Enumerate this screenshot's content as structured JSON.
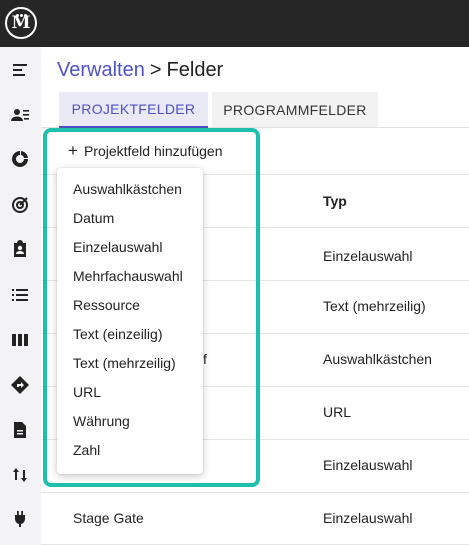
{
  "app": {
    "logo_text": "M"
  },
  "sidebar": {
    "icons": [
      "menu-icon",
      "user-list-icon",
      "donut-chart-icon",
      "target-icon",
      "clipboard-person-icon",
      "list-icon",
      "columns-icon",
      "direction-sign-icon",
      "document-icon",
      "sort-arrows-icon",
      "plug-icon"
    ]
  },
  "breadcrumb": {
    "parent": "Verwalten",
    "separator": ">",
    "current": "Felder"
  },
  "tabs": [
    {
      "label": "PROJEKTFELDER",
      "active": true
    },
    {
      "label": "PROGRAMMFELDER",
      "active": false
    }
  ],
  "add_button": {
    "icon": "+",
    "label": "Projektfeld hinzufügen"
  },
  "table": {
    "columns": [
      "Typ"
    ],
    "rows": [
      {
        "name": "",
        "type": "Einzelauswahl"
      },
      {
        "name": "",
        "type": "Text (mehrzeilig)"
      },
      {
        "name": "f",
        "type": "Auswahlkästchen"
      },
      {
        "name": "",
        "type": "URL"
      },
      {
        "name": "",
        "type": "Einzelauswahl"
      },
      {
        "name": "Stage Gate",
        "type": "Einzelauswahl"
      }
    ]
  },
  "dropdown": {
    "items": [
      "Auswahlkästchen",
      "Datum",
      "Einzelauswahl",
      "Mehrfachauswahl",
      "Ressource",
      "Text (einzeilig)",
      "Text (mehrzeilig)",
      "URL",
      "Währung",
      "Zahl"
    ]
  },
  "colors": {
    "accent": "#4d4fc4",
    "highlight": "#1fbfae",
    "topbar": "#262626"
  }
}
